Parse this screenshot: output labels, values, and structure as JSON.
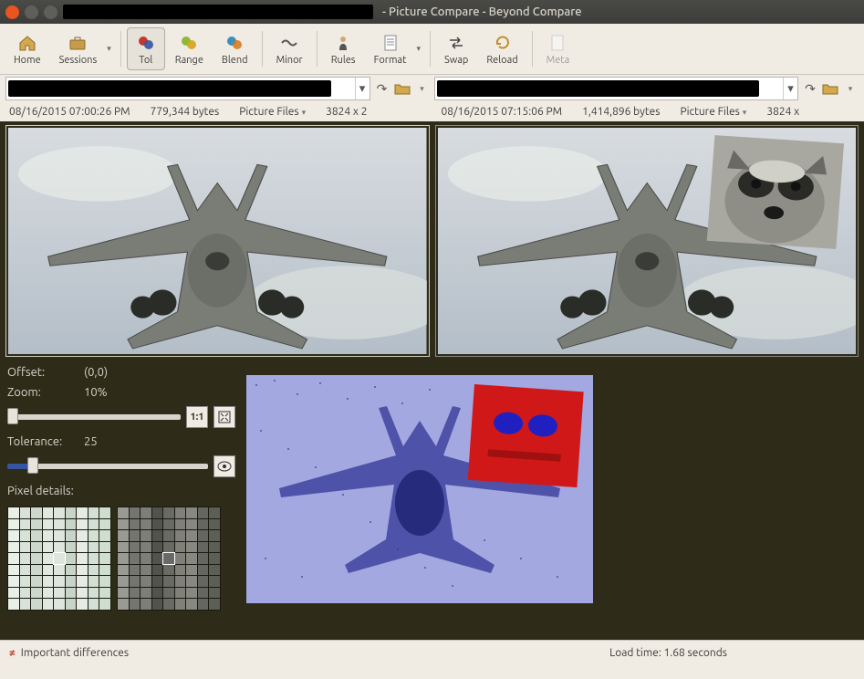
{
  "window": {
    "title": "- Picture Compare - Beyond Compare"
  },
  "toolbar": {
    "home": "Home",
    "sessions": "Sessions",
    "tol": "Tol",
    "range": "Range",
    "blend": "Blend",
    "minor": "Minor",
    "rules": "Rules",
    "format": "Format",
    "swap": "Swap",
    "reload": "Reload",
    "meta": "Meta"
  },
  "left": {
    "date": "08/16/2015 07:00:26 PM",
    "size": "779,344 bytes",
    "filter": "Picture Files",
    "dims": "3824 x 2"
  },
  "right": {
    "date": "08/16/2015 07:15:06 PM",
    "size": "1,414,896 bytes",
    "filter": "Picture Files",
    "dims": "3824 x"
  },
  "controls": {
    "offset_label": "Offset:",
    "offset_value": "(0,0)",
    "zoom_label": "Zoom:",
    "zoom_value": "10%",
    "one_to_one": "1:1",
    "tolerance_label": "Tolerance:",
    "tolerance_value": "25",
    "pixel_details": "Pixel details:"
  },
  "footer": {
    "diff_label": "Important differences",
    "load_time": "Load time: 1.68 seconds"
  }
}
